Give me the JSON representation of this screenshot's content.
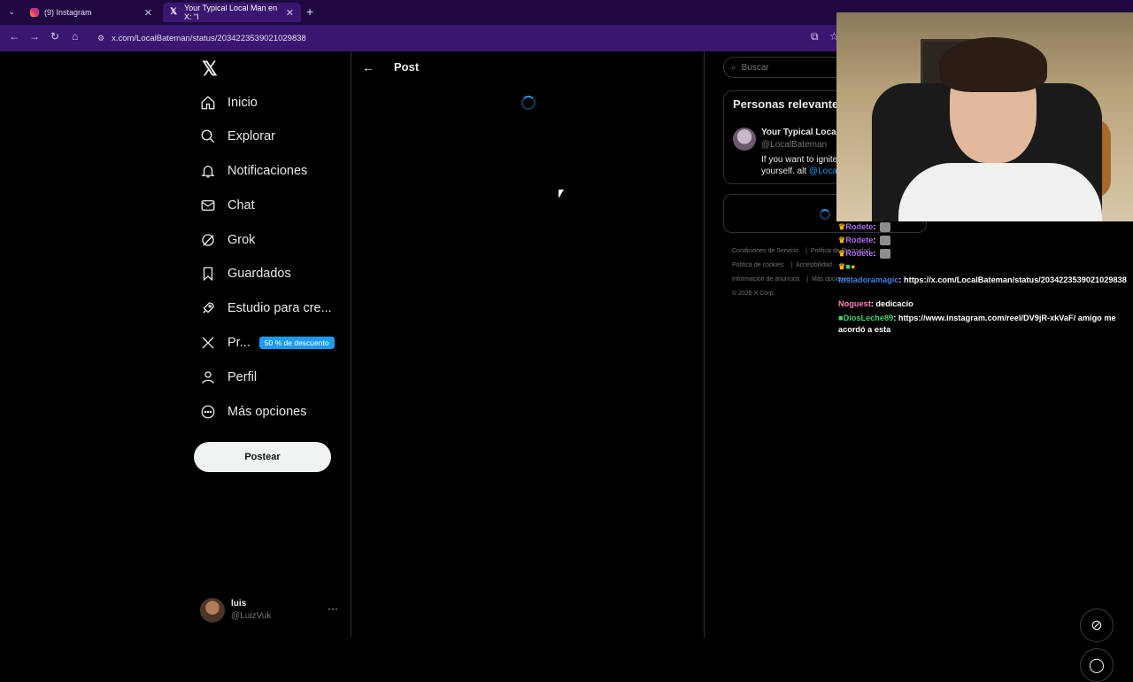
{
  "browser": {
    "tabs": [
      {
        "title": "(9) Instagram",
        "icon": "instagram-icon",
        "active": false
      },
      {
        "title": "Your Typical Local Man en X: \"I",
        "icon": "x-logo-icon",
        "active": true
      }
    ],
    "url": "x.com/LocalBateman/status/2034223539021029838",
    "colors": {
      "tabstrip": "#1f0840",
      "toolbar": "#3b1670"
    }
  },
  "nav": {
    "items": [
      {
        "label": "Inicio",
        "icon": "home-icon"
      },
      {
        "label": "Explorar",
        "icon": "search-icon"
      },
      {
        "label": "Notificaciones",
        "icon": "bell-icon"
      },
      {
        "label": "Chat",
        "icon": "mail-icon"
      },
      {
        "label": "Grok",
        "icon": "grok-icon"
      },
      {
        "label": "Guardados",
        "icon": "bookmark-icon"
      },
      {
        "label": "Estudio para cre...",
        "icon": "rocket-icon"
      },
      {
        "label": "Pr...",
        "icon": "x-logo-icon",
        "badge": "50 % de descuento"
      },
      {
        "label": "Perfil",
        "icon": "person-icon"
      },
      {
        "label": "Más opciones",
        "icon": "more-circle-icon"
      }
    ],
    "post_button": "Postear",
    "account": {
      "name": "luis",
      "handle": "@LuizVuk"
    }
  },
  "main": {
    "title": "Post",
    "loading": true
  },
  "sidebar": {
    "search_placeholder": "Buscar",
    "relevant": {
      "title": "Personas relevantes",
      "name": "Your Typical Local",
      "handle": "@LocalBateman",
      "bio_line1": "If you want to ignite",
      "bio_line2_text": "yourself. alt",
      "bio_line2_mention": "@Loca"
    },
    "footer": [
      "Condiciones de Servicio",
      "Política de Privacidad",
      "Política de cookies",
      "Accesibilidad",
      "Información de anuncios",
      "Más opciones ...",
      "© 2026 X Corp."
    ]
  },
  "stream_chat": [
    {
      "user": "Rodete",
      "message": ""
    },
    {
      "user": "Rodete",
      "message": ""
    },
    {
      "user": "Rodete",
      "message": ""
    },
    {
      "user": "tostadoramagic",
      "message": "https://x.com/LocalBateman/status/2034223539021029838"
    },
    {
      "user": "Noguest",
      "message": "dedicacio"
    },
    {
      "user": "DiosLeche89",
      "message": "https://www.instagram.com/reel/DV9jR-xkVaF/ amigo me acordó a esta"
    }
  ]
}
